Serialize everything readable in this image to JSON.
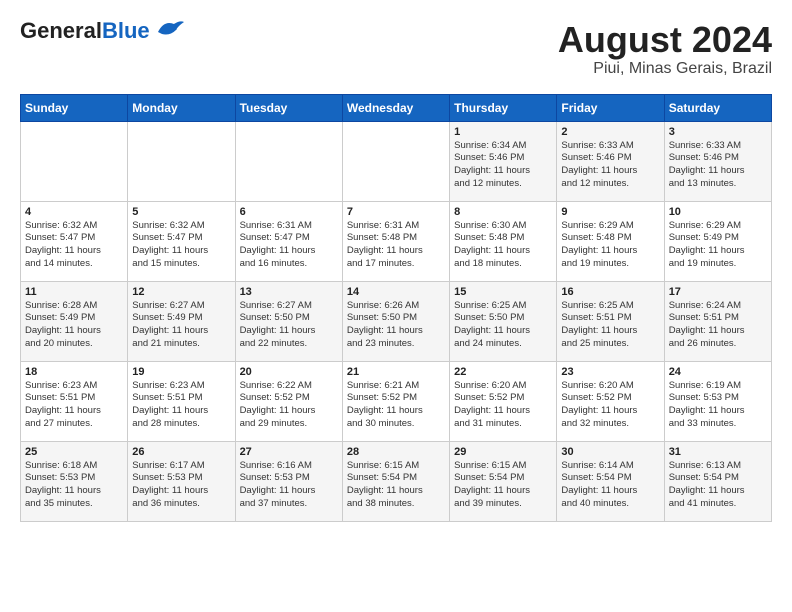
{
  "header": {
    "logo_general": "General",
    "logo_blue": "Blue",
    "title": "August 2024",
    "subtitle": "Piui, Minas Gerais, Brazil"
  },
  "weekdays": [
    "Sunday",
    "Monday",
    "Tuesday",
    "Wednesday",
    "Thursday",
    "Friday",
    "Saturday"
  ],
  "weeks": [
    [
      {
        "day": "",
        "info": ""
      },
      {
        "day": "",
        "info": ""
      },
      {
        "day": "",
        "info": ""
      },
      {
        "day": "",
        "info": ""
      },
      {
        "day": "1",
        "info": "Sunrise: 6:34 AM\nSunset: 5:46 PM\nDaylight: 11 hours\nand 12 minutes."
      },
      {
        "day": "2",
        "info": "Sunrise: 6:33 AM\nSunset: 5:46 PM\nDaylight: 11 hours\nand 12 minutes."
      },
      {
        "day": "3",
        "info": "Sunrise: 6:33 AM\nSunset: 5:46 PM\nDaylight: 11 hours\nand 13 minutes."
      }
    ],
    [
      {
        "day": "4",
        "info": "Sunrise: 6:32 AM\nSunset: 5:47 PM\nDaylight: 11 hours\nand 14 minutes."
      },
      {
        "day": "5",
        "info": "Sunrise: 6:32 AM\nSunset: 5:47 PM\nDaylight: 11 hours\nand 15 minutes."
      },
      {
        "day": "6",
        "info": "Sunrise: 6:31 AM\nSunset: 5:47 PM\nDaylight: 11 hours\nand 16 minutes."
      },
      {
        "day": "7",
        "info": "Sunrise: 6:31 AM\nSunset: 5:48 PM\nDaylight: 11 hours\nand 17 minutes."
      },
      {
        "day": "8",
        "info": "Sunrise: 6:30 AM\nSunset: 5:48 PM\nDaylight: 11 hours\nand 18 minutes."
      },
      {
        "day": "9",
        "info": "Sunrise: 6:29 AM\nSunset: 5:48 PM\nDaylight: 11 hours\nand 19 minutes."
      },
      {
        "day": "10",
        "info": "Sunrise: 6:29 AM\nSunset: 5:49 PM\nDaylight: 11 hours\nand 19 minutes."
      }
    ],
    [
      {
        "day": "11",
        "info": "Sunrise: 6:28 AM\nSunset: 5:49 PM\nDaylight: 11 hours\nand 20 minutes."
      },
      {
        "day": "12",
        "info": "Sunrise: 6:27 AM\nSunset: 5:49 PM\nDaylight: 11 hours\nand 21 minutes."
      },
      {
        "day": "13",
        "info": "Sunrise: 6:27 AM\nSunset: 5:50 PM\nDaylight: 11 hours\nand 22 minutes."
      },
      {
        "day": "14",
        "info": "Sunrise: 6:26 AM\nSunset: 5:50 PM\nDaylight: 11 hours\nand 23 minutes."
      },
      {
        "day": "15",
        "info": "Sunrise: 6:25 AM\nSunset: 5:50 PM\nDaylight: 11 hours\nand 24 minutes."
      },
      {
        "day": "16",
        "info": "Sunrise: 6:25 AM\nSunset: 5:51 PM\nDaylight: 11 hours\nand 25 minutes."
      },
      {
        "day": "17",
        "info": "Sunrise: 6:24 AM\nSunset: 5:51 PM\nDaylight: 11 hours\nand 26 minutes."
      }
    ],
    [
      {
        "day": "18",
        "info": "Sunrise: 6:23 AM\nSunset: 5:51 PM\nDaylight: 11 hours\nand 27 minutes."
      },
      {
        "day": "19",
        "info": "Sunrise: 6:23 AM\nSunset: 5:51 PM\nDaylight: 11 hours\nand 28 minutes."
      },
      {
        "day": "20",
        "info": "Sunrise: 6:22 AM\nSunset: 5:52 PM\nDaylight: 11 hours\nand 29 minutes."
      },
      {
        "day": "21",
        "info": "Sunrise: 6:21 AM\nSunset: 5:52 PM\nDaylight: 11 hours\nand 30 minutes."
      },
      {
        "day": "22",
        "info": "Sunrise: 6:20 AM\nSunset: 5:52 PM\nDaylight: 11 hours\nand 31 minutes."
      },
      {
        "day": "23",
        "info": "Sunrise: 6:20 AM\nSunset: 5:52 PM\nDaylight: 11 hours\nand 32 minutes."
      },
      {
        "day": "24",
        "info": "Sunrise: 6:19 AM\nSunset: 5:53 PM\nDaylight: 11 hours\nand 33 minutes."
      }
    ],
    [
      {
        "day": "25",
        "info": "Sunrise: 6:18 AM\nSunset: 5:53 PM\nDaylight: 11 hours\nand 35 minutes."
      },
      {
        "day": "26",
        "info": "Sunrise: 6:17 AM\nSunset: 5:53 PM\nDaylight: 11 hours\nand 36 minutes."
      },
      {
        "day": "27",
        "info": "Sunrise: 6:16 AM\nSunset: 5:53 PM\nDaylight: 11 hours\nand 37 minutes."
      },
      {
        "day": "28",
        "info": "Sunrise: 6:15 AM\nSunset: 5:54 PM\nDaylight: 11 hours\nand 38 minutes."
      },
      {
        "day": "29",
        "info": "Sunrise: 6:15 AM\nSunset: 5:54 PM\nDaylight: 11 hours\nand 39 minutes."
      },
      {
        "day": "30",
        "info": "Sunrise: 6:14 AM\nSunset: 5:54 PM\nDaylight: 11 hours\nand 40 minutes."
      },
      {
        "day": "31",
        "info": "Sunrise: 6:13 AM\nSunset: 5:54 PM\nDaylight: 11 hours\nand 41 minutes."
      }
    ]
  ]
}
